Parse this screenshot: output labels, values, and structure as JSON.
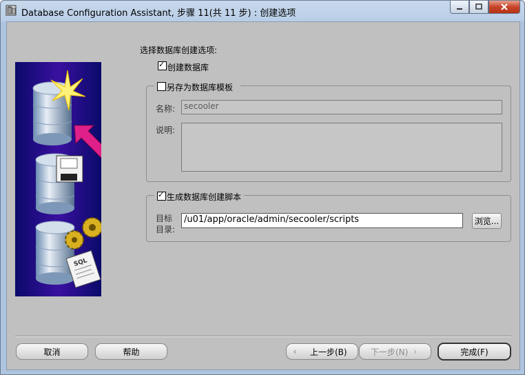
{
  "window": {
    "title": "Database Configuration Assistant, 步骤 11(共 11 步) : 创建选项"
  },
  "options": {
    "heading": "选择数据库创建选项:",
    "create_db_label": "创建数据库",
    "create_db_checked": true,
    "save_template_label": "另存为数据库模板",
    "save_template_checked": false,
    "name_label": "名称:",
    "name_value": "secooler",
    "desc_label": "说明:",
    "desc_value": "",
    "gen_scripts_label": "生成数据库创建脚本",
    "gen_scripts_checked": true,
    "target_label_1": "目标",
    "target_label_2": "目录:",
    "target_value": "/u01/app/oracle/admin/secooler/scripts",
    "browse_label": "浏览..."
  },
  "footer": {
    "cancel_label": "取消",
    "help_label": "帮助",
    "back_label": "上一步(B)",
    "next_label": "下一步(N)",
    "finish_label": "完成(F)"
  },
  "illustration": {
    "sql_text": "SQL"
  },
  "colors": {
    "client_bg": "#c0c0c0",
    "illustration_bg": "#0b0b7a",
    "arrow": "#e0208a",
    "title_bar": "#b8cde6"
  }
}
